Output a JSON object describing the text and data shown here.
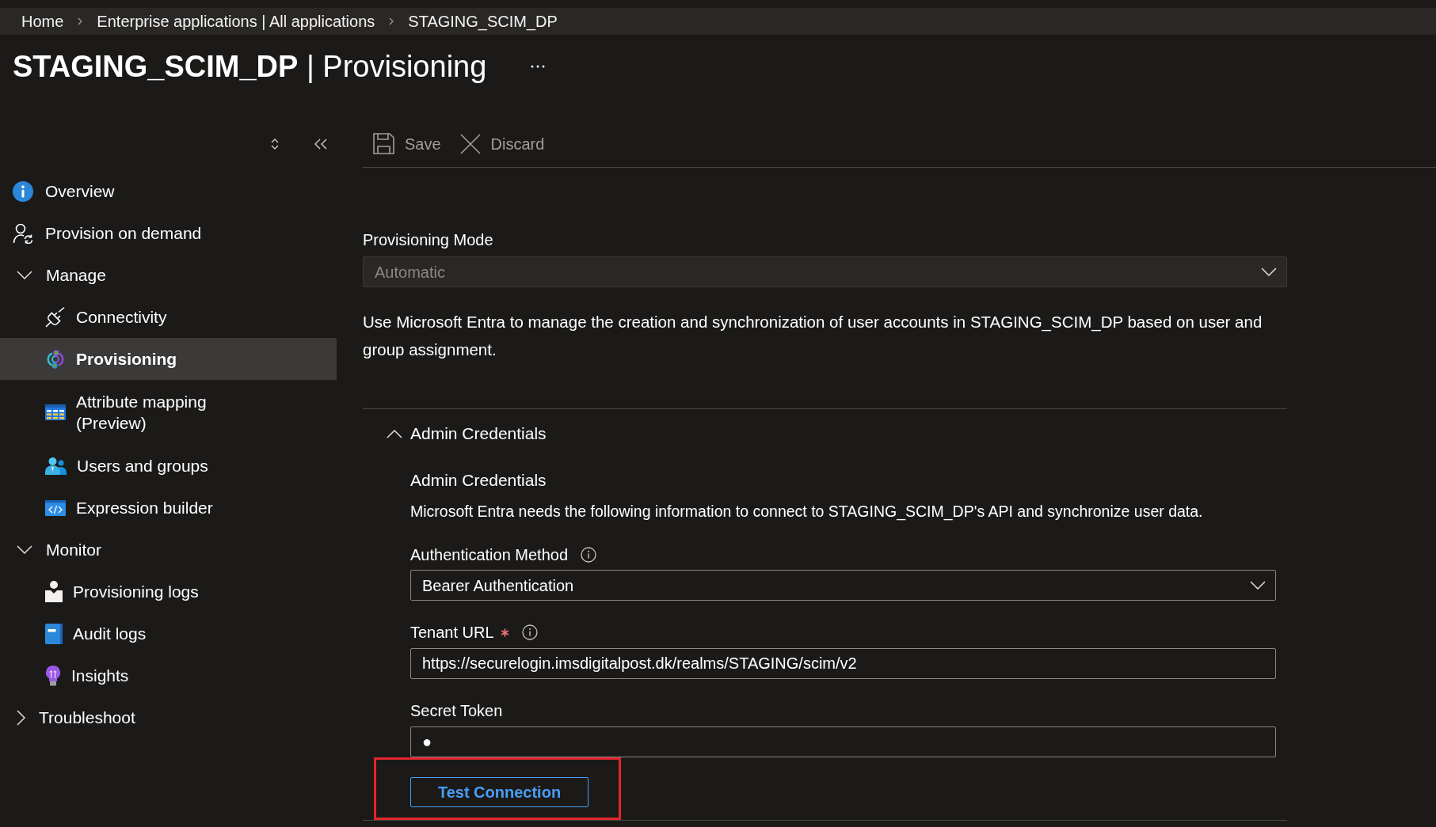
{
  "breadcrumb": [
    {
      "label": "Home"
    },
    {
      "label": "Enterprise applications | All applications"
    },
    {
      "label": "STAGING_SCIM_DP"
    }
  ],
  "page_title": "**STAGING_SCIM_DP** | Provisioning",
  "sidebar": {
    "items": [
      {
        "kind": "link",
        "label": "Overview",
        "selected": false
      },
      {
        "kind": "link",
        "label": "Provision on demand",
        "selected": false
      },
      {
        "kind": "group",
        "label": "Manage",
        "expanded": true,
        "children": [
          {
            "label": "Connectivity",
            "selected": false
          },
          {
            "label": "Provisioning",
            "selected": true
          },
          {
            "label": "Attribute mapping (Preview)",
            "selected": false
          },
          {
            "label": "Users and groups",
            "selected": false
          },
          {
            "label": "Expression builder",
            "selected": false
          }
        ]
      },
      {
        "kind": "group",
        "label": "Monitor",
        "expanded": true,
        "children": [
          {
            "label": "Provisioning logs",
            "selected": false
          },
          {
            "label": "Audit logs",
            "selected": false
          },
          {
            "label": "Insights",
            "selected": false
          }
        ]
      },
      {
        "kind": "group",
        "label": "Troubleshoot",
        "expanded": false
      }
    ]
  },
  "toolbar": {
    "buttons": [
      {
        "label": "Save",
        "disabled": true
      },
      {
        "label": "Discard",
        "disabled": true
      }
    ]
  },
  "provisioning_mode": {
    "label": "Provisioning Mode",
    "value": "Automatic",
    "disabled": true
  },
  "description": "Use Microsoft Entra to manage the creation and synchronization of user accounts in STAGING_SCIM_DP based on user and group assignment.",
  "admin_credentials": {
    "title": "Admin Credentials",
    "expanded": true,
    "heading": "Admin Credentials",
    "description": "Microsoft Entra needs the following information to connect to STAGING_SCIM_DP's API and synchronize user data.",
    "fields": [
      {
        "kind": "dropdown",
        "label": "Authentication Method",
        "required": false,
        "info": true,
        "value": "Bearer Authentication"
      },
      {
        "kind": "text",
        "label": "Tenant URL",
        "required": true,
        "info": true,
        "value": "https://securelogin.imsdigitalpost.dk/realms/STAGING/scim/v2"
      },
      {
        "kind": "password",
        "label": "Secret Token",
        "required": false,
        "info": false,
        "value": "●"
      }
    ],
    "test_button": {
      "label": "Test Connection",
      "highlighted": true
    }
  }
}
